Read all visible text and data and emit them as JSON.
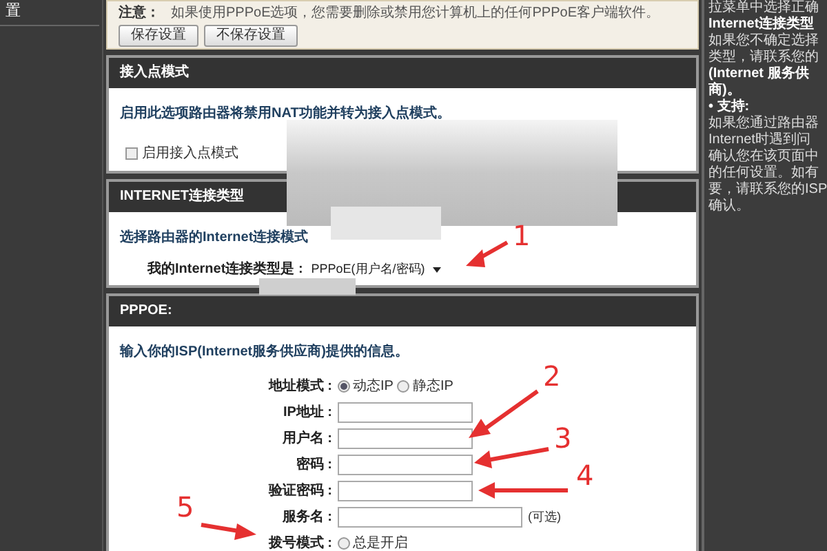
{
  "left_sidebar": {
    "item": "置"
  },
  "notice": {
    "label": "注意：",
    "text": "如果使用PPPoE选项，您需要删除或禁用您计算机上的任何PPPoE客户端软件。",
    "buttons": [
      "保存设置",
      "不保存设置"
    ]
  },
  "ap_mode": {
    "title": "接入点模式",
    "description": "启用此选项路由器将禁用NAT功能并转为接入点模式。",
    "checkbox": {
      "label": "启用接入点模式",
      "checked": false
    }
  },
  "connection_type": {
    "title": "INTERNET连接类型",
    "description": "选择路由器的Internet连接模式",
    "field_label": "我的Internet连接类型是 :",
    "value": "PPPoE(用户名/密码)"
  },
  "pppoe": {
    "title": "PPPOE:",
    "description": "输入你的ISP(Internet服务供应商)提供的信息。",
    "address_mode": {
      "label": "地址模式 :",
      "options": [
        {
          "label": "动态IP",
          "selected": true
        },
        {
          "label": "静态IP",
          "selected": false
        }
      ]
    },
    "fields": [
      {
        "label": "IP地址 :"
      },
      {
        "label": "用户名 :"
      },
      {
        "label": "密码 :"
      },
      {
        "label": "验证密码 :"
      },
      {
        "label": "服务名 :",
        "note": "(可选)"
      }
    ],
    "dial_mode": {
      "label": "拨号模式 :",
      "options": [
        {
          "label": "总是开启",
          "selected": false
        }
      ]
    }
  },
  "help_sidebar": {
    "lines": [
      {
        "kind": "text",
        "text": "拉菜单中选择正确"
      },
      {
        "kind": "heading",
        "text": "Internet连接类型"
      },
      {
        "kind": "text",
        "text": "如果您不确定选择"
      },
      {
        "kind": "text",
        "text": "类型，请联系您的"
      },
      {
        "kind": "heading",
        "text": "(Internet 服务供"
      },
      {
        "kind": "heading",
        "text": "商)。"
      },
      {
        "kind": "heading",
        "text": "• 支持:"
      },
      {
        "kind": "text",
        "text": "如果您通过路由器"
      },
      {
        "kind": "text",
        "text": "Internet时遇到问"
      },
      {
        "kind": "text",
        "text": "确认您在该页面中"
      },
      {
        "kind": "text",
        "text": "的任何设置。如有"
      },
      {
        "kind": "text",
        "text": "要，请联系您的ISP"
      },
      {
        "kind": "text",
        "text": "确认。"
      }
    ]
  },
  "annotations": [
    "1",
    "2",
    "3",
    "4",
    "5"
  ]
}
